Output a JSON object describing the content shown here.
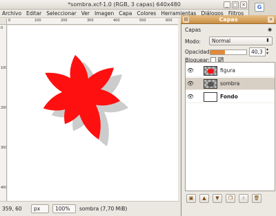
{
  "window": {
    "title": "*sombra.xcf-1.0 (RGB, 3 capas) 640x480",
    "minimize": "_",
    "maximize": "□",
    "close": "×"
  },
  "menu": [
    "Archivo",
    "Editar",
    "Seleccionar",
    "Ver",
    "Imagen",
    "Capa",
    "Colores",
    "Herramientas",
    "Diálogos",
    "Filtros"
  ],
  "ruler": {
    "top": [
      "0",
      "100",
      "200",
      "300",
      "400",
      "500",
      "600"
    ],
    "left": [
      "0",
      "100",
      "200",
      "300",
      "400"
    ]
  },
  "status": {
    "coords": "359, 60",
    "unit": "px",
    "zoom": "100%",
    "info": "sombra (7,70 MiB)"
  },
  "layers_dialog": {
    "title": "Capas",
    "header": "Capas",
    "mode_label": "Modo:",
    "mode_value": "Normal",
    "opacity_label": "Opacidad:",
    "opacity_value": "40,3",
    "lock_label": "Bloquear:",
    "layers": [
      {
        "name": "figura",
        "visible": true,
        "selected": false
      },
      {
        "name": "sombra",
        "visible": true,
        "selected": true
      },
      {
        "name": "Fondo",
        "visible": true,
        "selected": false
      }
    ]
  },
  "colors": {
    "flower": "#ff1010",
    "shadow": "#9a9a9a",
    "selected_row": "#d8d0c4",
    "title_orange": "#c98f43"
  },
  "browser": {
    "search_letter": "G"
  }
}
